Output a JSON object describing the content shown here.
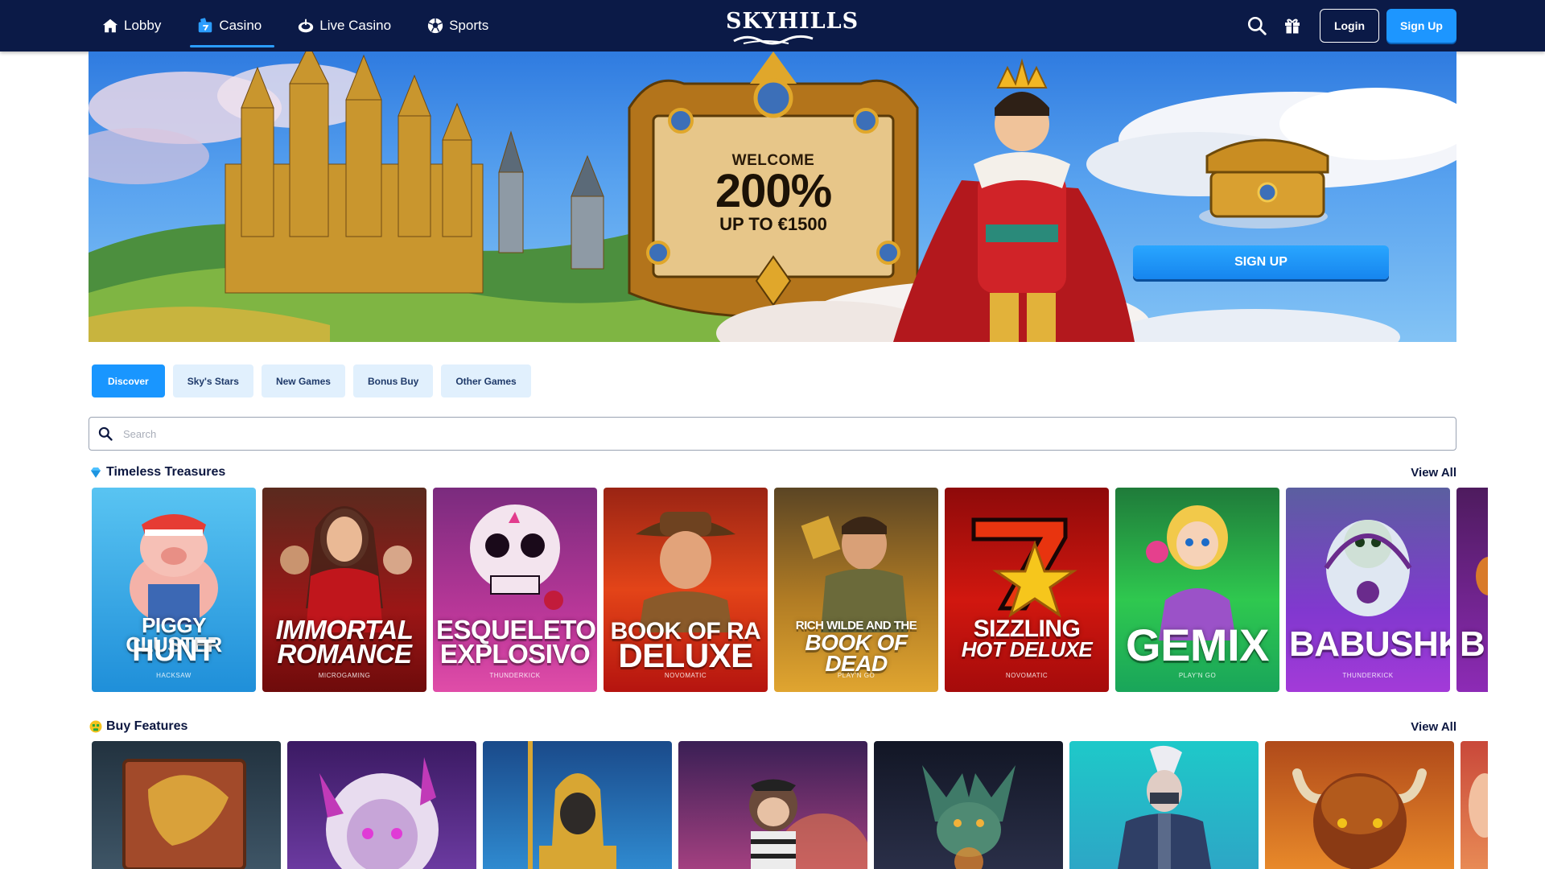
{
  "header": {
    "nav": [
      {
        "label": "Lobby",
        "icon": "home-icon"
      },
      {
        "label": "Casino",
        "icon": "casino-icon",
        "active": true
      },
      {
        "label": "Live Casino",
        "icon": "live-casino-icon"
      },
      {
        "label": "Sports",
        "icon": "soccer-ball-icon"
      }
    ],
    "logo": "SKYHILLS",
    "login_label": "Login",
    "signup_label": "Sign Up"
  },
  "banner": {
    "welcome": "WELCOME",
    "bonus": "200%",
    "bonus_sub": "UP TO €1500",
    "cta_label": "SIGN UP"
  },
  "tabs": [
    {
      "label": "Discover",
      "active": true
    },
    {
      "label": "Sky's Stars"
    },
    {
      "label": "New Games"
    },
    {
      "label": "Bonus Buy"
    },
    {
      "label": "Other Games"
    }
  ],
  "search": {
    "placeholder": "Search",
    "value": ""
  },
  "sections": [
    {
      "title": "Timeless Treasures",
      "icon": "diamond-icon",
      "view_all": "View All",
      "games": [
        {
          "name_line1": "PIGGY CLUSTER",
          "name_line2": "HUNT",
          "provider": "HACKSAW",
          "bg": "#2aa5e8"
        },
        {
          "name_line1": "IMMORTAL",
          "name_line2": "ROMANCE",
          "provider": "MICROGAMING",
          "bg": "#8e1414"
        },
        {
          "name_line1": "ESQUELETO",
          "name_line2": "EXPLOSIVO",
          "provider": "THUNDERKICK",
          "bg": "#b5379c"
        },
        {
          "name_line1": "BOOK OF RA",
          "name_line2": "DELUXE",
          "provider": "NOVOMATIC",
          "bg": "#c8201b"
        },
        {
          "name_line1": "RICH WILDE AND THE",
          "name_line2": "BOOK OF DEAD",
          "provider": "PLAY'N GO",
          "bg": "#c9911d"
        },
        {
          "name_line1": "SIZZLING",
          "name_line2": "HOT DELUXE",
          "provider": "NOVOMATIC",
          "bg": "#c4100d"
        },
        {
          "name_line1": "",
          "name_line2": "GEMIX",
          "provider": "PLAY'N GO",
          "bg": "#1fb64d"
        },
        {
          "name_line1": "",
          "name_line2": "BABUSHKAS",
          "provider": "THUNDERKICK",
          "bg": "#8433c9"
        },
        {
          "name_line1": "",
          "name_line2": "B",
          "provider": "",
          "bg": "#7d2aa8"
        }
      ]
    },
    {
      "title": "Buy Features",
      "icon": "money-face-icon",
      "view_all": "View All",
      "games": [
        {
          "bg": "#3d5366",
          "accent": "#c9832e",
          "icon": "dragon-shield-icon"
        },
        {
          "bg": "#5a2a86",
          "accent": "#e3c6f0",
          "icon": "demon-girl-icon"
        },
        {
          "bg": "#1f6fb6",
          "accent": "#d6a72d",
          "icon": "pharaoh-icon"
        },
        {
          "bg": "#7a2f7a",
          "accent": "#f2c49b",
          "icon": "monkey-icon"
        },
        {
          "bg": "#1c2236",
          "accent": "#4f8a73",
          "icon": "dragon-icon"
        },
        {
          "bg": "#27c0c9",
          "accent": "#2f3f66",
          "icon": "ninja-icon"
        },
        {
          "bg": "#b25a1c",
          "accent": "#f0b347",
          "icon": "buffalo-icon"
        },
        {
          "bg": "#c9483a",
          "accent": "#e88a55",
          "icon": "partial-tile-icon"
        }
      ]
    }
  ],
  "colors": {
    "header_bg": "#0b1a47",
    "accent": "#1996ff",
    "tab_bg": "#e1f0fd",
    "text_dark": "#0c1740"
  }
}
